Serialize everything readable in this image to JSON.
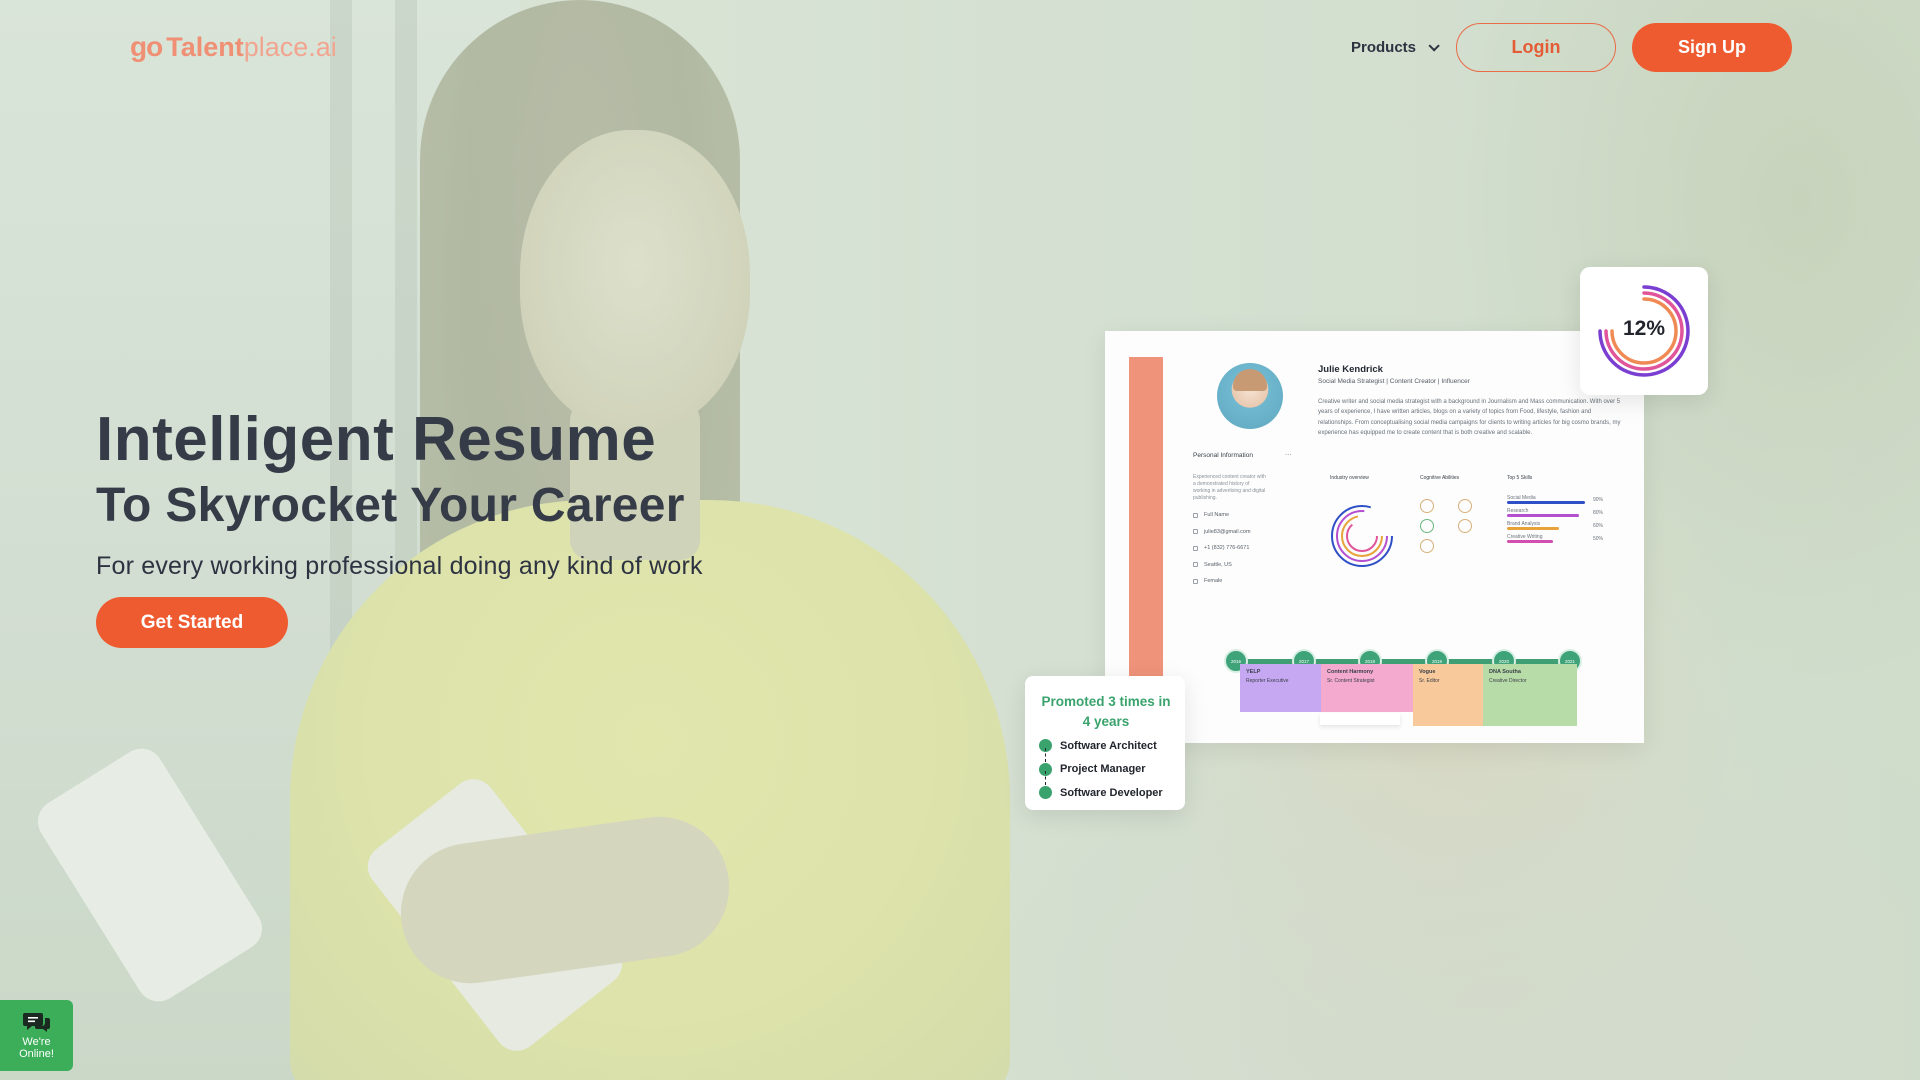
{
  "header": {
    "logo": {
      "mark": "go",
      "brand": "Talent",
      "domain": "place.ai"
    },
    "nav": {
      "products_label": "Products",
      "login_label": "Login",
      "signup_label": "Sign Up"
    }
  },
  "hero": {
    "title_line1": "Intelligent Resume",
    "title_line2": "To Skyrocket Your Career",
    "subtitle": "For every working professional doing any kind of work",
    "cta_label": "Get Started"
  },
  "resume_preview": {
    "name": "Julie Kendrick",
    "role": "Social Media Strategist | Content Creator | Influencer",
    "bio": "Creative writer and social media strategist with a background in Journalism and Mass communication. With over 5 years of experience, I have written articles, blogs on a variety of topics from Food, lifestyle, fashion and relationships. From conceptualising social media campaigns for clients to writing articles for big cosmo brands, my experience has equipped me to create content that is both creative and scalable.",
    "personal_info_heading": "Personal Information",
    "personal_summary": "Experienced content creator with a demonstrated history of working in advertising and digital publishing.",
    "info_rows": [
      "Full Name",
      "julie83@gmail.com",
      "+1 (832) 776-6671",
      "Seattle, US",
      "Female"
    ],
    "industry_heading": "Industry overview",
    "cognitive_heading": "Cognitive Abilities",
    "skills_heading": "Top 5 Skills",
    "skills": [
      {
        "label": "Social Media",
        "pct": "90%",
        "color": "#2f4fc7"
      },
      {
        "label": "Research",
        "pct": "80%",
        "color": "#b44fd0"
      },
      {
        "label": "Brand Analysis",
        "pct": "60%",
        "color": "#e7a23a"
      },
      {
        "label": "Creative Writing",
        "pct": "50%",
        "color": "#d14fb0"
      }
    ],
    "timeline": [
      {
        "year": "2016"
      },
      {
        "year": "2017",
        "company": "YELP",
        "title": "Reporter Executive",
        "color": "#c6a8f2"
      },
      {
        "year": "2018",
        "company": "Content Harmony",
        "title": "Sr. Content Strategist",
        "color": "#f4a9cf"
      },
      {
        "year": "2019",
        "company": "Vogue",
        "title": "Sr. Editor",
        "color": "#f8c99a"
      },
      {
        "year": "2020",
        "company": "DNA Southa",
        "title": "Creative Director",
        "color": "#b8dca7"
      },
      {
        "year": "2021"
      }
    ]
  },
  "growth_card": {
    "value": "12%",
    "colors": [
      "#f08a55",
      "#e0549a",
      "#7a3fd1"
    ]
  },
  "promotion_card": {
    "heading": "Promoted 3 times in 4 years",
    "roles": [
      "Software Architect",
      "Project Manager",
      "Software Developer"
    ]
  },
  "chat_widget": {
    "label_line1": "We're",
    "label_line2": "Online!"
  },
  "colors": {
    "accent": "#ef5b31",
    "heading": "#363b48",
    "success": "#3aa36d"
  }
}
